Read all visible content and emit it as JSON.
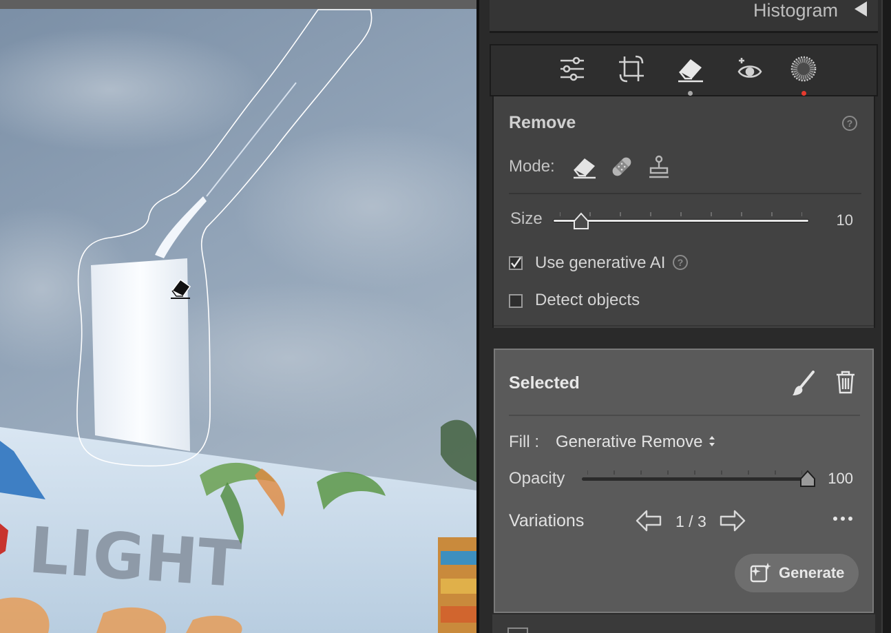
{
  "histogram": {
    "title": "Histogram"
  },
  "tools": [
    {
      "name": "edit-sliders-icon",
      "active": false
    },
    {
      "name": "crop-icon",
      "active": false
    },
    {
      "name": "remove-eraser-icon",
      "active": true
    },
    {
      "name": "red-eye-icon",
      "active": false
    },
    {
      "name": "masking-icon",
      "active": false,
      "has_alert": true
    }
  ],
  "colors": {
    "accent_alert": "#e63a2e",
    "active_dot": "#a8a8a8"
  },
  "remove": {
    "title": "Remove",
    "mode_label": "Mode:",
    "modes": [
      "eraser-icon",
      "heal-bandage-icon",
      "clone-stamp-icon"
    ],
    "size_label": "Size",
    "size_value": "10",
    "size_fraction": 0.11,
    "use_generative_ai": {
      "label": "Use generative AI",
      "checked": true
    },
    "detect_objects": {
      "label": "Detect objects",
      "checked": false
    }
  },
  "selected": {
    "title": "Selected",
    "fill_label": "Fill :",
    "fill_value": "Generative Remove",
    "opacity_label": "Opacity",
    "opacity_value": "100",
    "opacity_fraction": 1.0,
    "variations_label": "Variations",
    "variation_count": "1 / 3",
    "generate_label": "Generate"
  },
  "photo": {
    "sign_text": "LIGHT"
  }
}
